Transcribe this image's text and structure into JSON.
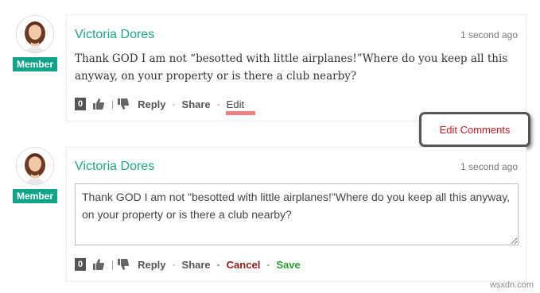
{
  "comments": [
    {
      "author": "Victoria Dores",
      "role": "Member",
      "time": "1 second ago",
      "text": "Thank GOD I am not “besotted with little airplanes!”Where do you keep all this anyway, on your property or is there a club nearby?",
      "votes": "0",
      "actions": {
        "reply": "Reply",
        "share": "Share",
        "edit": "Edit",
        "sep": "-",
        "bar": "|"
      }
    },
    {
      "author": "Victoria Dores",
      "role": "Member",
      "time": "1 second ago",
      "edit_value": "Thank GOD I am not \"besotted with little airplanes!\"Where do you keep all this anyway, on your property or is there a club nearby?",
      "votes": "0",
      "actions": {
        "reply": "Reply",
        "share": "Share",
        "cancel": "Cancel",
        "save": "Save",
        "sep": "-",
        "bar": "|"
      }
    }
  ],
  "callout": {
    "label": "Edit Comments"
  },
  "colors": {
    "accent": "#12a489",
    "author": "#1fa589",
    "callout_text": "#c0181e",
    "cancel": "#8b1a1a",
    "save": "#2a9d2a",
    "edit_highlight": "#f08080"
  },
  "watermark": "wsxdn.com"
}
